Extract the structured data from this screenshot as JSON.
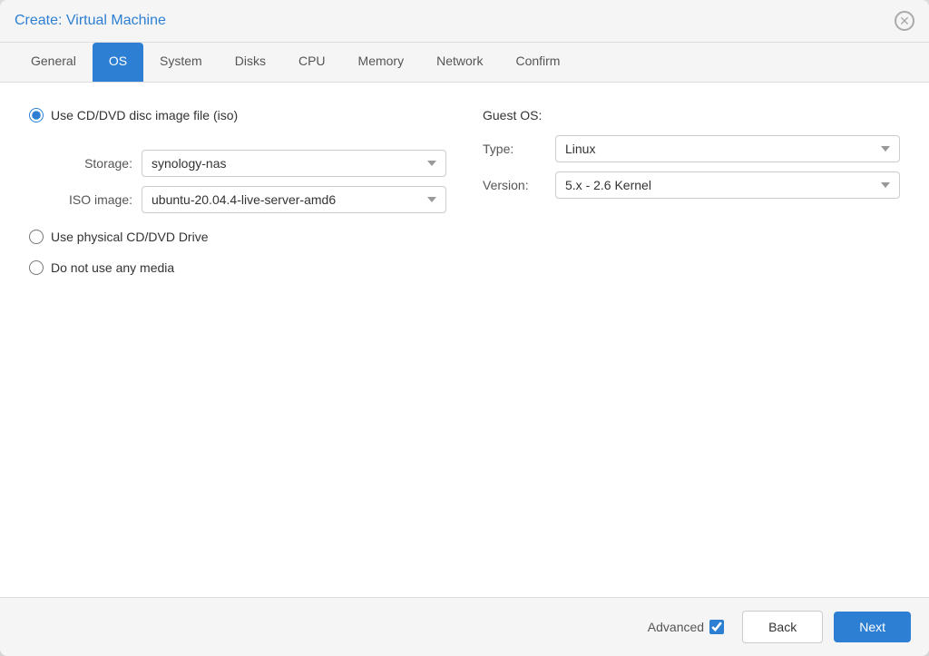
{
  "dialog": {
    "title": "Create: Virtual Machine"
  },
  "tabs": [
    {
      "id": "general",
      "label": "General",
      "active": false
    },
    {
      "id": "os",
      "label": "OS",
      "active": true
    },
    {
      "id": "system",
      "label": "System",
      "active": false
    },
    {
      "id": "disks",
      "label": "Disks",
      "active": false
    },
    {
      "id": "cpu",
      "label": "CPU",
      "active": false
    },
    {
      "id": "memory",
      "label": "Memory",
      "active": false
    },
    {
      "id": "network",
      "label": "Network",
      "active": false
    },
    {
      "id": "confirm",
      "label": "Confirm",
      "active": false
    }
  ],
  "os_section": {
    "radio_options": [
      {
        "id": "cd_dvd",
        "label": "Use CD/DVD disc image file (iso)",
        "selected": true
      },
      {
        "id": "physical",
        "label": "Use physical CD/DVD Drive",
        "selected": false
      },
      {
        "id": "no_media",
        "label": "Do not use any media",
        "selected": false
      }
    ],
    "storage_label": "Storage:",
    "storage_value": "synology-nas",
    "iso_label": "ISO image:",
    "iso_value": "ubuntu-20.04.4-live-server-amd6",
    "guest_os": {
      "title": "Guest OS:",
      "type_label": "Type:",
      "type_value": "Linux",
      "version_label": "Version:",
      "version_value": "5.x - 2.6 Kernel"
    }
  },
  "footer": {
    "advanced_label": "Advanced",
    "back_label": "Back",
    "next_label": "Next"
  }
}
